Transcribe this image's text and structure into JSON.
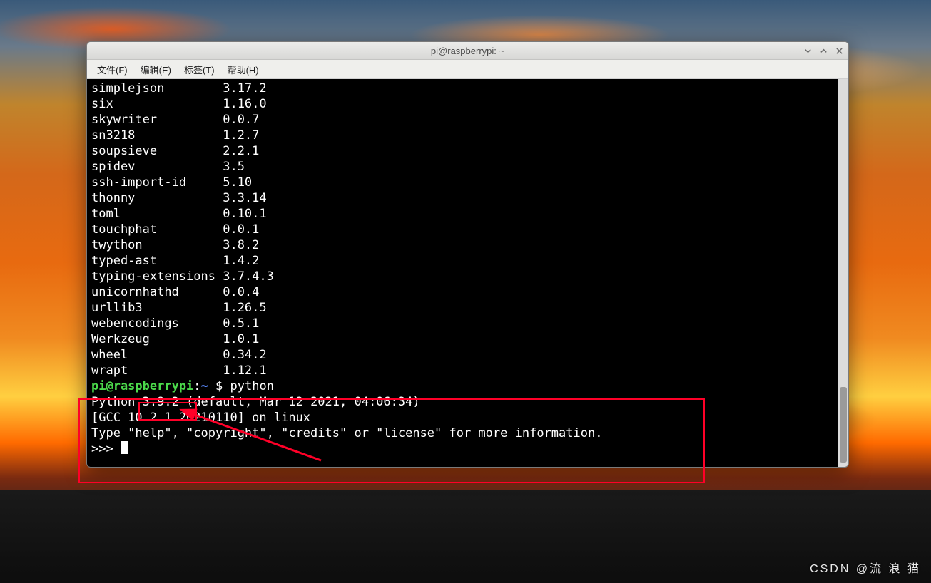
{
  "window": {
    "title": "pi@raspberrypi: ~"
  },
  "menu": {
    "file": "文件(F)",
    "edit": "编辑(E)",
    "tabs": "标签(T)",
    "help": "帮助(H)"
  },
  "pkg_listing": [
    {
      "name": "simplejson",
      "version": "3.17.2"
    },
    {
      "name": "six",
      "version": "1.16.0"
    },
    {
      "name": "skywriter",
      "version": "0.0.7"
    },
    {
      "name": "sn3218",
      "version": "1.2.7"
    },
    {
      "name": "soupsieve",
      "version": "2.2.1"
    },
    {
      "name": "spidev",
      "version": "3.5"
    },
    {
      "name": "ssh-import-id",
      "version": "5.10"
    },
    {
      "name": "thonny",
      "version": "3.3.14"
    },
    {
      "name": "toml",
      "version": "0.10.1"
    },
    {
      "name": "touchphat",
      "version": "0.0.1"
    },
    {
      "name": "twython",
      "version": "3.8.2"
    },
    {
      "name": "typed-ast",
      "version": "1.4.2"
    },
    {
      "name": "typing-extensions",
      "version": "3.7.4.3"
    },
    {
      "name": "unicornhathd",
      "version": "0.0.4"
    },
    {
      "name": "urllib3",
      "version": "1.26.5"
    },
    {
      "name": "webencodings",
      "version": "0.5.1"
    },
    {
      "name": "Werkzeug",
      "version": "1.0.1"
    },
    {
      "name": "wheel",
      "version": "0.34.2"
    },
    {
      "name": "wrapt",
      "version": "1.12.1"
    }
  ],
  "prompt": {
    "user_host": "pi@raspberrypi",
    "colon": ":",
    "path": "~",
    "dollar": " $ ",
    "cmd": "python"
  },
  "python_out": {
    "line1_a": "Python ",
    "line1_ver": "3.9.2",
    "line1_b": " (default, Mar 12 2021, 04:06:34)",
    "line2": "[GCC 10.2.1 20210110] on linux",
    "line3": "Type \"help\", \"copyright\", \"credits\" or \"license\" for more information.",
    "repl": ">>> "
  },
  "watermark": "CSDN @流 浪 猫"
}
